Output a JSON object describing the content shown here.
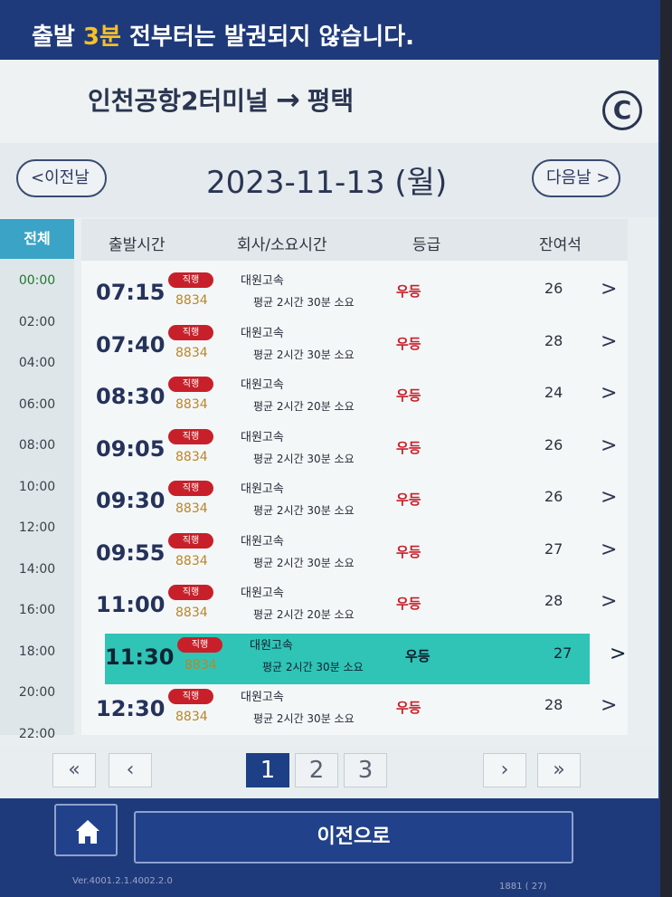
{
  "notice": {
    "prefix": "출발 ",
    "highlight": "3분",
    "suffix": " 전부터는 발권되지 않습니다."
  },
  "route": {
    "origin": "인천공항2터미널",
    "arrow": "→",
    "destination": "평택",
    "copyright_symbol": "C"
  },
  "date_bar": {
    "prev_label": "<이전날",
    "date": "2023-11-13 (월)",
    "next_label": "다음날 >"
  },
  "time_filter": {
    "all_label": "전체",
    "slots": [
      "00:00",
      "02:00",
      "04:00",
      "06:00",
      "08:00",
      "10:00",
      "12:00",
      "14:00",
      "16:00",
      "18:00",
      "20:00",
      "22:00"
    ],
    "active_slot": "00:00"
  },
  "list_header": {
    "departure": "출발시간",
    "company": "회사/소요시간",
    "grade": "등급",
    "seats": "잔여석"
  },
  "rows": [
    {
      "time": "07:15",
      "badge": "직행",
      "bus_no": "8834",
      "company": "대원고속",
      "duration": "평균 2시간 30분 소요",
      "grade": "우등",
      "seats": "26",
      "chev": ">"
    },
    {
      "time": "07:40",
      "badge": "직행",
      "bus_no": "8834",
      "company": "대원고속",
      "duration": "평균 2시간 30분 소요",
      "grade": "우등",
      "seats": "28",
      "chev": ">"
    },
    {
      "time": "08:30",
      "badge": "직행",
      "bus_no": "8834",
      "company": "대원고속",
      "duration": "평균 2시간 20분 소요",
      "grade": "우등",
      "seats": "24",
      "chev": ">"
    },
    {
      "time": "09:05",
      "badge": "직행",
      "bus_no": "8834",
      "company": "대원고속",
      "duration": "평균 2시간 30분 소요",
      "grade": "우등",
      "seats": "26",
      "chev": ">"
    },
    {
      "time": "09:30",
      "badge": "직행",
      "bus_no": "8834",
      "company": "대원고속",
      "duration": "평균 2시간 30분 소요",
      "grade": "우등",
      "seats": "26",
      "chev": ">"
    },
    {
      "time": "09:55",
      "badge": "직행",
      "bus_no": "8834",
      "company": "대원고속",
      "duration": "평균 2시간 30분 소요",
      "grade": "우등",
      "seats": "27",
      "chev": ">"
    },
    {
      "time": "11:00",
      "badge": "직행",
      "bus_no": "8834",
      "company": "대원고속",
      "duration": "평균 2시간 20분 소요",
      "grade": "우등",
      "seats": "28",
      "chev": ">"
    },
    {
      "time": "11:30",
      "badge": "직행",
      "bus_no": "8834",
      "company": "대원고속",
      "duration": "평균 2시간 30분 소요",
      "grade": "우등",
      "seats": "27",
      "chev": ">"
    },
    {
      "time": "12:30",
      "badge": "직행",
      "bus_no": "8834",
      "company": "대원고속",
      "duration": "평균 2시간 30분 소요",
      "grade": "우등",
      "seats": "28",
      "chev": ">"
    }
  ],
  "selected_row": "11:30",
  "pager": {
    "first": "«",
    "prev": "‹",
    "pages": [
      "1",
      "2",
      "3"
    ],
    "current": "1",
    "next": "›",
    "last": "»"
  },
  "bottom": {
    "back_label": "이전으로",
    "version": "Ver.4001.2.1.4002.2.0",
    "corner_info": "1881 (  27)"
  },
  "colors": {
    "brand_blue": "#1f3a7a",
    "accent_teal": "#2fc4b6",
    "grade_red": "#c7202a",
    "badge_red": "#c8202a",
    "highlight_yellow": "#f6c026"
  }
}
